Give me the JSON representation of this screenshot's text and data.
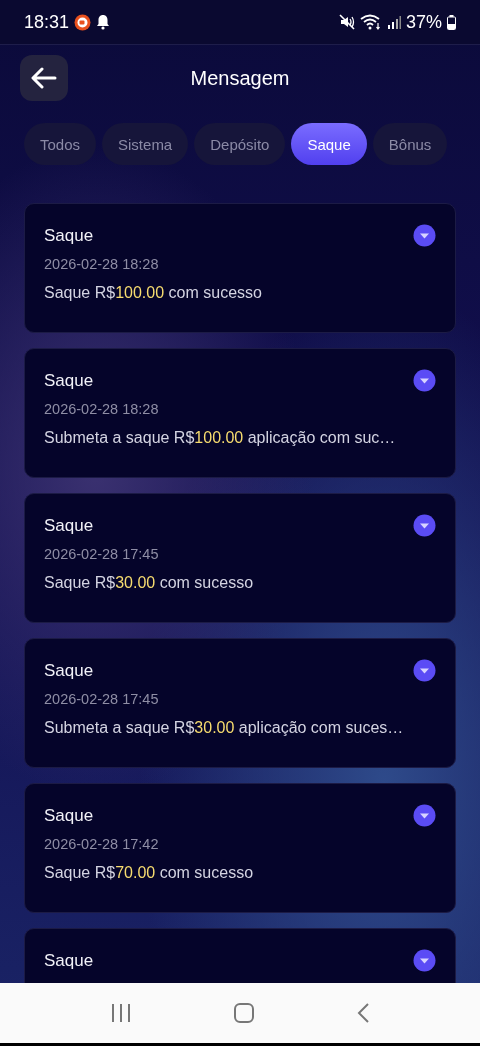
{
  "status_bar": {
    "time": "18:31",
    "battery": "37%"
  },
  "header": {
    "title": "Mensagem"
  },
  "tabs": [
    {
      "label": "Todos",
      "selected": false
    },
    {
      "label": "Sistema",
      "selected": false
    },
    {
      "label": "Depósito",
      "selected": false
    },
    {
      "label": "Saque",
      "selected": true
    },
    {
      "label": "Bônus",
      "selected": false
    }
  ],
  "messages": [
    {
      "title": "Saque",
      "date": "2026-02-28 18:28",
      "body": {
        "before": "Saque R$",
        "amount": "100.00",
        "after": " com sucesso"
      }
    },
    {
      "title": "Saque",
      "date": "2026-02-28 18:28",
      "body": {
        "before": "Submeta a saque R$",
        "amount": "100.00",
        "after": " aplicação com suc…"
      }
    },
    {
      "title": "Saque",
      "date": "2026-02-28 17:45",
      "body": {
        "before": "Saque R$",
        "amount": "30.00",
        "after": " com sucesso"
      }
    },
    {
      "title": "Saque",
      "date": "2026-02-28 17:45",
      "body": {
        "before": "Submeta a saque R$",
        "amount": "30.00",
        "after": " aplicação com suces…"
      }
    },
    {
      "title": "Saque",
      "date": "2026-02-28 17:42",
      "body": {
        "before": "Saque R$",
        "amount": "70.00",
        "after": " com sucesso"
      }
    },
    {
      "title": "Saque"
    }
  ]
}
